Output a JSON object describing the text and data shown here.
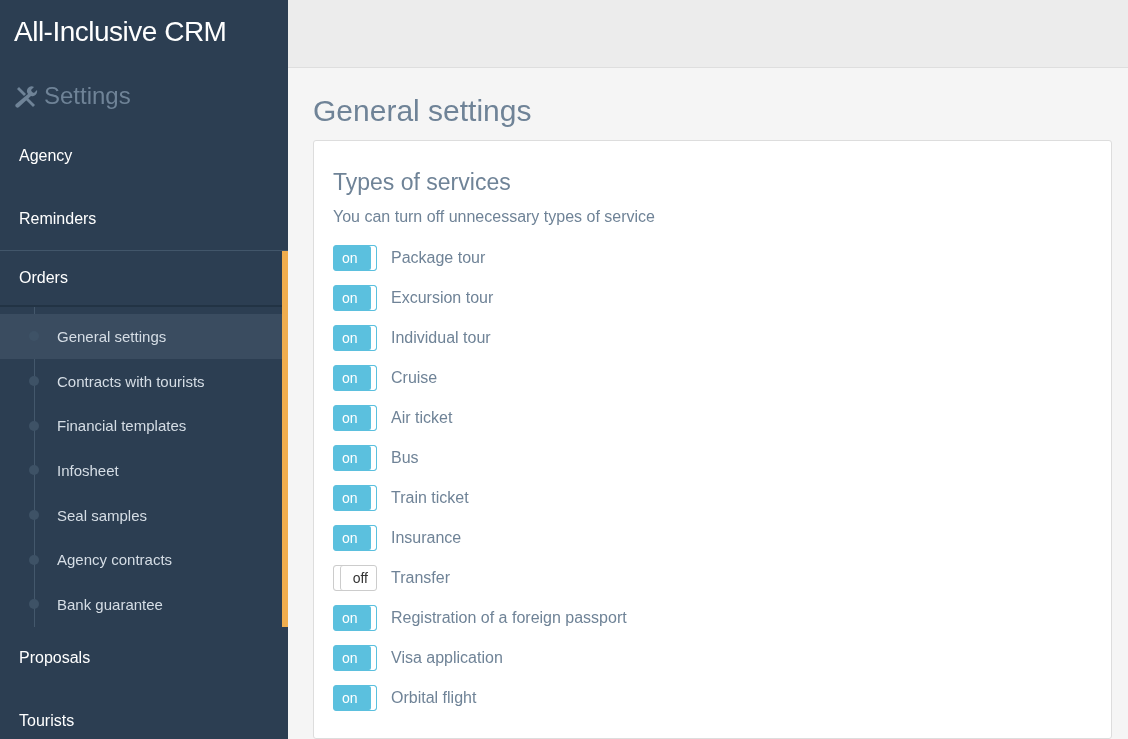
{
  "sidebar": {
    "brand": "All-Inclusive CRM",
    "section_title": "Settings",
    "items": [
      {
        "label": "Agency",
        "expanded": false
      },
      {
        "label": "Reminders",
        "expanded": false
      },
      {
        "label": "Orders",
        "expanded": true,
        "children": [
          {
            "label": "General settings",
            "selected": true
          },
          {
            "label": "Contracts with tourists",
            "selected": false
          },
          {
            "label": "Financial templates",
            "selected": false
          },
          {
            "label": "Infosheet",
            "selected": false
          },
          {
            "label": "Seal samples",
            "selected": false
          },
          {
            "label": "Agency contracts",
            "selected": false
          },
          {
            "label": "Bank guarantee",
            "selected": false
          }
        ]
      },
      {
        "label": "Proposals",
        "expanded": false
      },
      {
        "label": "Tourists",
        "expanded": false
      }
    ]
  },
  "page": {
    "title": "General settings",
    "card": {
      "title": "Types of services",
      "description": "You can turn off unnecessary types of service",
      "services": [
        {
          "label": "Package tour",
          "on": true,
          "switch_text": "on"
        },
        {
          "label": "Excursion tour",
          "on": true,
          "switch_text": "on"
        },
        {
          "label": "Individual tour",
          "on": true,
          "switch_text": "on"
        },
        {
          "label": "Cruise",
          "on": true,
          "switch_text": "on"
        },
        {
          "label": "Air ticket",
          "on": true,
          "switch_text": "on"
        },
        {
          "label": "Bus",
          "on": true,
          "switch_text": "on"
        },
        {
          "label": "Train ticket",
          "on": true,
          "switch_text": "on"
        },
        {
          "label": "Insurance",
          "on": true,
          "switch_text": "on"
        },
        {
          "label": "Transfer",
          "on": false,
          "switch_text": "off"
        },
        {
          "label": "Registration of a foreign passport",
          "on": true,
          "switch_text": "on"
        },
        {
          "label": "Visa application",
          "on": true,
          "switch_text": "on"
        },
        {
          "label": "Orbital flight",
          "on": true,
          "switch_text": "on"
        }
      ]
    }
  }
}
